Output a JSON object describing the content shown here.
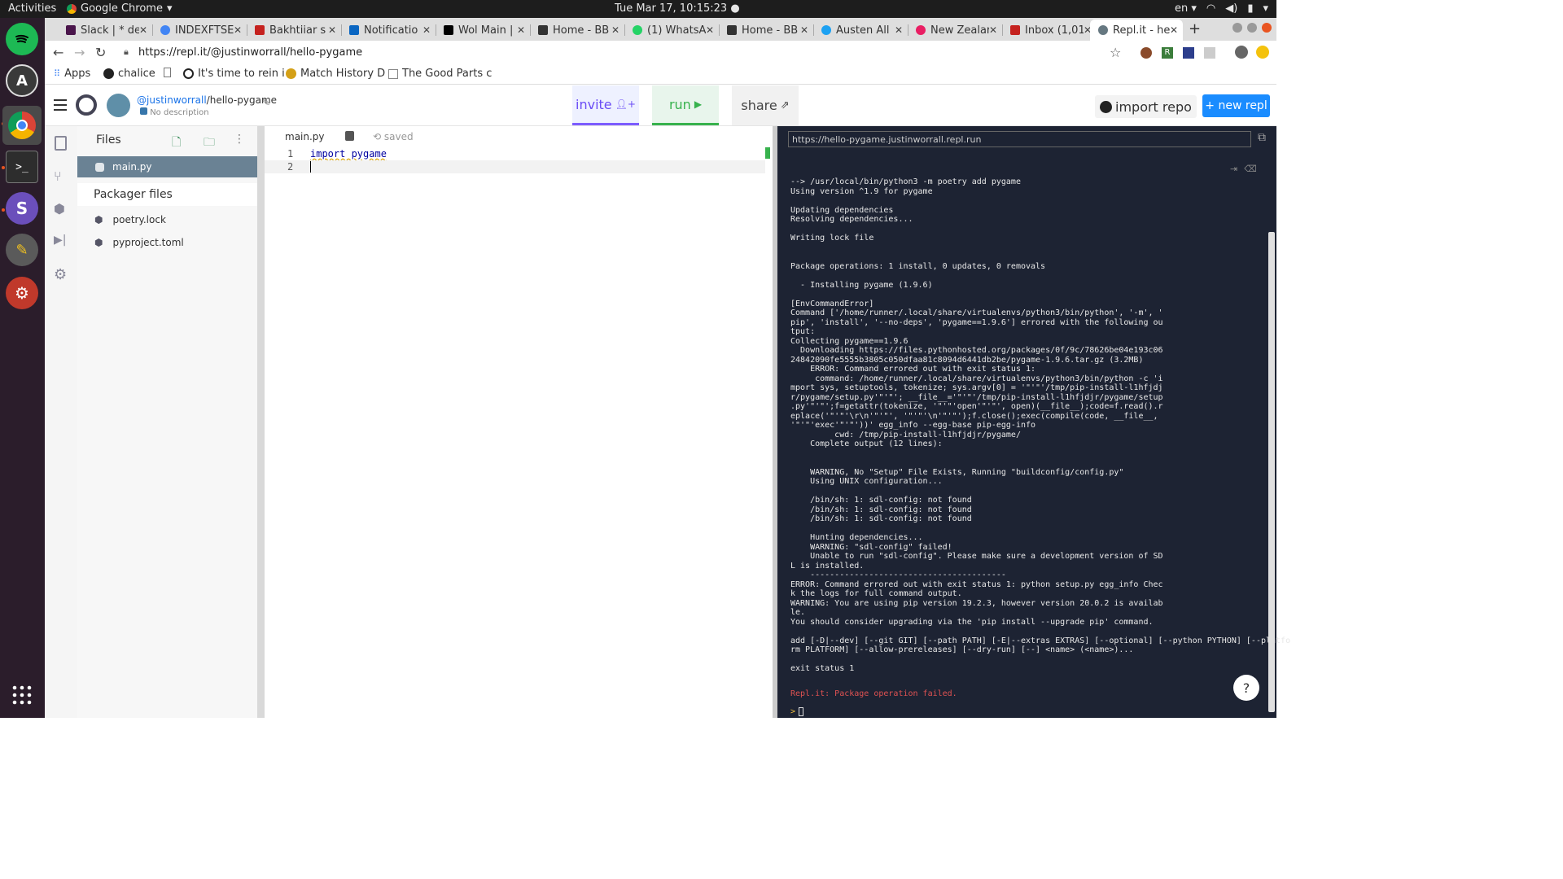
{
  "os": {
    "activities": "Activities",
    "app_name": "Google Chrome",
    "clock": "Tue Mar 17, 10:15:23",
    "lang": "en"
  },
  "tabs": [
    {
      "title": "Slack | * de",
      "color": "#4a154b"
    },
    {
      "title": "INDEXFTSE",
      "color": "#4285f4"
    },
    {
      "title": "Bakhtiiar s",
      "color": "#c5221f"
    },
    {
      "title": "Notificatio",
      "color": "#0a66c2"
    },
    {
      "title": "Wol Main |",
      "color": "#000000"
    },
    {
      "title": "Home - BB",
      "color": "#333333"
    },
    {
      "title": "(1) WhatsA",
      "color": "#25d366"
    },
    {
      "title": "Home - BB",
      "color": "#333333"
    },
    {
      "title": "Austen All",
      "color": "#1da1f2"
    },
    {
      "title": "New Zealar",
      "color": "#e91e63"
    },
    {
      "title": "Inbox (1,01",
      "color": "#c5221f"
    },
    {
      "title": "Repl.it - hel",
      "color": "#667881"
    }
  ],
  "browser": {
    "url": "https://repl.it/@justinworrall/hello-pygame",
    "bookmarks": [
      "Apps",
      "chalice",
      "It's time to rein i",
      "Match History D",
      "The Good Parts c"
    ]
  },
  "repl": {
    "owner": "@justinworrall",
    "slug": "/hello-pygame",
    "description": "No description",
    "invite": "invite",
    "run": "run",
    "share": "share",
    "import_repo": "import repo",
    "new_repl": "+ new repl"
  },
  "files": {
    "title": "Files",
    "items": [
      "main.py"
    ],
    "packager_title": "Packager files",
    "packager_items": [
      "poetry.lock",
      "pyproject.toml"
    ]
  },
  "editor": {
    "tab": "main.py",
    "status": "saved",
    "lines": [
      {
        "num": "1",
        "code": "import pygame"
      },
      {
        "num": "2",
        "code": ""
      }
    ]
  },
  "console": {
    "url": "https://hello-pygame.justinworrall.repl.run",
    "output": "--> /usr/local/bin/python3 -m poetry add pygame\nUsing version ^1.9 for pygame\n\nUpdating dependencies\nResolving dependencies...\n\nWriting lock file\n\n\nPackage operations: 1 install, 0 updates, 0 removals\n\n  - Installing pygame (1.9.6)\n\n[EnvCommandError]\nCommand ['/home/runner/.local/share/virtualenvs/python3/bin/python', '-m', '\npip', 'install', '--no-deps', 'pygame==1.9.6'] errored with the following ou\ntput:\nCollecting pygame==1.9.6\n  Downloading https://files.pythonhosted.org/packages/0f/9c/78626be04e193c06\n24842090fe5555b3805c050dfaa81c8094d6441db2be/pygame-1.9.6.tar.gz (3.2MB)\n    ERROR: Command errored out with exit status 1:\n     command: /home/runner/.local/share/virtualenvs/python3/bin/python -c 'i\nmport sys, setuptools, tokenize; sys.argv[0] = '\"'\"'/tmp/pip-install-l1hfjdj\nr/pygame/setup.py'\"'\"'; __file__='\"'\"'/tmp/pip-install-l1hfjdjr/pygame/setup\n.py'\"'\"';f=getattr(tokenize, '\"'\"'open'\"'\"', open)(__file__);code=f.read().r\neplace('\"'\"'\\r\\n'\"'\"', '\"'\"'\\n'\"'\"');f.close();exec(compile(code, __file__,\n'\"'\"'exec'\"'\"'))' egg_info --egg-base pip-egg-info\n         cwd: /tmp/pip-install-l1hfjdjr/pygame/\n    Complete output (12 lines):\n\n\n    WARNING, No \"Setup\" File Exists, Running \"buildconfig/config.py\"\n    Using UNIX configuration...\n\n    /bin/sh: 1: sdl-config: not found\n    /bin/sh: 1: sdl-config: not found\n    /bin/sh: 1: sdl-config: not found\n\n    Hunting dependencies...\n    WARNING: \"sdl-config\" failed!\n    Unable to run \"sdl-config\". Please make sure a development version of SD\nL is installed.\n    ----------------------------------------\nERROR: Command errored out with exit status 1: python setup.py egg_info Chec\nk the logs for full command output.\nWARNING: You are using pip version 19.2.3, however version 20.0.2 is availab\nle.\nYou should consider upgrading via the 'pip install --upgrade pip' command.\n\nadd [-D|--dev] [--git GIT] [--path PATH] [-E|--extras EXTRAS] [--optional] [--python PYTHON] [--platfo\nrm PLATFORM] [--allow-prereleases] [--dry-run] [--] <name> (<name>)...\n\nexit status 1",
    "error": "Repl.it: Package operation failed.",
    "prompt": ">",
    "help": "?"
  },
  "colors": {
    "accent_blue": "#1a8cff",
    "invite_border": "#7c5cff",
    "run_green": "#37b24d",
    "console_bg": "#1d2333",
    "error_red": "#e05252"
  }
}
